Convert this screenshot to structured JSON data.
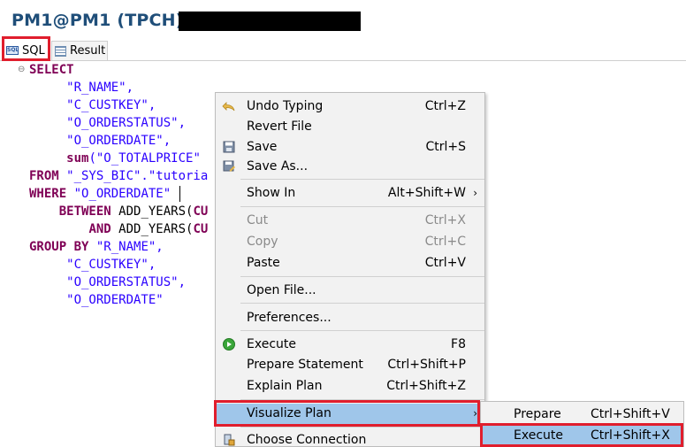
{
  "title": "PM1@PM1 (TPCH)",
  "tabs": [
    {
      "label": "SQL",
      "icon": "sql-icon"
    },
    {
      "label": "Result",
      "icon": "result-grid-icon"
    }
  ],
  "editor": {
    "lines": [
      {
        "parts": [
          {
            "t": "SELECT",
            "c": "kw"
          }
        ]
      },
      {
        "parts": [
          {
            "t": "     \"R_NAME\",",
            "c": "str"
          }
        ]
      },
      {
        "parts": [
          {
            "t": "     \"C_CUSTKEY\",",
            "c": "str"
          }
        ]
      },
      {
        "parts": [
          {
            "t": "     \"O_ORDERSTATUS\",",
            "c": "str"
          }
        ]
      },
      {
        "parts": [
          {
            "t": "     \"O_ORDERDATE\",",
            "c": "str"
          }
        ]
      },
      {
        "parts": [
          {
            "t": "     ",
            "c": "str"
          },
          {
            "t": "sum",
            "c": "kw"
          },
          {
            "t": "(\"O_TOTALPRICE\"",
            "c": "str"
          }
        ]
      },
      {
        "parts": [
          {
            "t": "FROM",
            "c": "kw"
          },
          {
            "t": " \"_SYS_BIC\".\"tutoria",
            "c": "str"
          }
        ]
      },
      {
        "parts": [
          {
            "t": "WHERE",
            "c": "kw"
          },
          {
            "t": " \"O_ORDERDATE\"",
            "c": "str"
          }
        ]
      },
      {
        "parts": [
          {
            "t": "    ",
            "c": "str"
          },
          {
            "t": "BETWEEN",
            "c": "kw"
          },
          {
            "t": " ADD_YEARS(",
            "c": "fn"
          },
          {
            "t": "CU",
            "c": "kw"
          }
        ]
      },
      {
        "parts": [
          {
            "t": "        ",
            "c": "str"
          },
          {
            "t": "AND",
            "c": "kw"
          },
          {
            "t": " ADD_YEARS(",
            "c": "fn"
          },
          {
            "t": "CU",
            "c": "kw"
          }
        ]
      },
      {
        "parts": [
          {
            "t": "GROUP BY",
            "c": "kw"
          },
          {
            "t": " \"R_NAME\",",
            "c": "str"
          }
        ]
      },
      {
        "parts": [
          {
            "t": "     \"C_CUSTKEY\",",
            "c": "str"
          }
        ]
      },
      {
        "parts": [
          {
            "t": "     \"O_ORDERSTATUS\",",
            "c": "str"
          }
        ]
      },
      {
        "parts": [
          {
            "t": "     \"O_ORDERDATE\"",
            "c": "str"
          }
        ]
      }
    ]
  },
  "context_menu": {
    "items": [
      {
        "label": "Undo Typing",
        "shortcut": "Ctrl+Z",
        "icon": "undo-icon",
        "disabled": false
      },
      {
        "label": "Revert File",
        "shortcut": "",
        "icon": "",
        "disabled": false
      },
      {
        "label": "Save",
        "shortcut": "Ctrl+S",
        "icon": "save-icon",
        "disabled": false
      },
      {
        "label": "Save As...",
        "shortcut": "",
        "icon": "save-as-icon",
        "disabled": false
      },
      {
        "label": "Show In",
        "shortcut": "Alt+Shift+W",
        "icon": "",
        "disabled": false,
        "submenu": true
      },
      {
        "label": "Cut",
        "shortcut": "Ctrl+X",
        "icon": "",
        "disabled": true
      },
      {
        "label": "Copy",
        "shortcut": "Ctrl+C",
        "icon": "",
        "disabled": true
      },
      {
        "label": "Paste",
        "shortcut": "Ctrl+V",
        "icon": "",
        "disabled": false
      },
      {
        "label": "Open File...",
        "shortcut": "",
        "icon": "",
        "disabled": false
      },
      {
        "label": "Preferences...",
        "shortcut": "",
        "icon": "",
        "disabled": false
      },
      {
        "label": "Execute",
        "shortcut": "F8",
        "icon": "execute-icon",
        "disabled": false
      },
      {
        "label": "Prepare Statement",
        "shortcut": "Ctrl+Shift+P",
        "icon": "",
        "disabled": false
      },
      {
        "label": "Explain Plan",
        "shortcut": "Ctrl+Shift+Z",
        "icon": "",
        "disabled": false
      },
      {
        "label": "Visualize Plan",
        "shortcut": "",
        "icon": "",
        "disabled": false,
        "submenu": true,
        "highlighted": true
      },
      {
        "label": "Choose Connection",
        "shortcut": "",
        "icon": "connection-icon",
        "disabled": false
      }
    ]
  },
  "submenu": {
    "items": [
      {
        "label": "Prepare",
        "shortcut": "Ctrl+Shift+V"
      },
      {
        "label": "Execute",
        "shortcut": "Ctrl+Shift+X",
        "highlighted": true
      }
    ]
  },
  "colors": {
    "highlight_box": "#e01e2d",
    "menu_selection": "#9fc6ea",
    "title": "#1f4e79",
    "keyword": "#7f0055",
    "string": "#2a00ff"
  },
  "submenu_arrow": "›"
}
